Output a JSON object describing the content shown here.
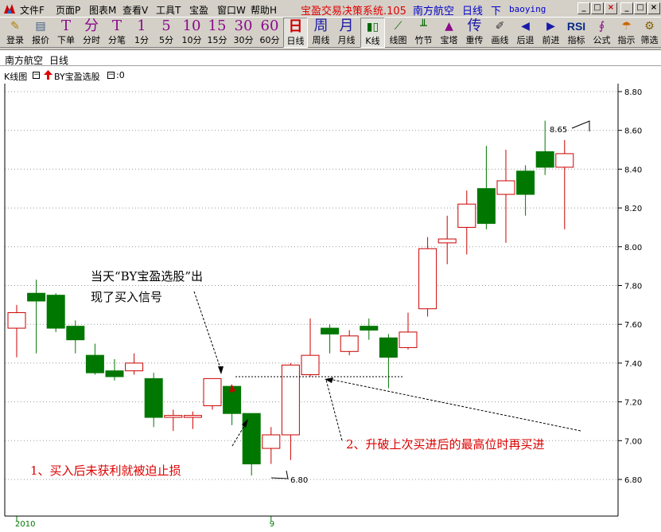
{
  "menu": {
    "items": [
      "文件F",
      "页面P",
      "图表M",
      "查看V",
      "工具T",
      "宝盈",
      "窗口W",
      "帮助H"
    ],
    "app_title": "宝盈交易决策系统.105",
    "stock_name": "南方航空",
    "period": "日线",
    "down_label": "下",
    "user": "baoying"
  },
  "toolbar": {
    "buttons": [
      {
        "icon": "✎",
        "label": "登录",
        "icon_name": "pen-icon"
      },
      {
        "icon": "▤",
        "label": "报价",
        "icon_name": "quote-icon"
      },
      {
        "icon": "T",
        "label": "下单",
        "icon_name": "order-icon"
      },
      {
        "icon": "分",
        "label": "分时",
        "icon_name": "minute-icon"
      },
      {
        "icon": "T",
        "label": "分笔",
        "icon_name": "tick-icon"
      },
      {
        "icon": "1",
        "label": "1分"
      },
      {
        "icon": "5",
        "label": "5分"
      },
      {
        "icon": "10",
        "label": "10分"
      },
      {
        "icon": "15",
        "label": "15分"
      },
      {
        "icon": "30",
        "label": "30分"
      },
      {
        "icon": "60",
        "label": "60分"
      },
      {
        "icon": "日",
        "label": "日线"
      },
      {
        "icon": "周",
        "label": "周线"
      },
      {
        "icon": "月",
        "label": "月线"
      },
      {
        "icon": "▮▯",
        "label": "K线",
        "icon_name": "candlestick-icon"
      },
      {
        "icon": "⟋",
        "label": "线图",
        "icon_name": "line-chart-icon"
      },
      {
        "icon": "╨",
        "label": "竹节",
        "icon_name": "bamboo-icon"
      },
      {
        "icon": "▲",
        "label": "宝塔",
        "icon_name": "tower-icon"
      },
      {
        "icon": "传",
        "label": "重传"
      },
      {
        "icon": "✐",
        "label": "画线",
        "icon_name": "draw-line-icon"
      },
      {
        "icon": "◀",
        "label": "后退",
        "icon_name": "back-icon"
      },
      {
        "icon": "▶",
        "label": "前进",
        "icon_name": "forward-icon"
      },
      {
        "icon": "RSI",
        "label": "指标",
        "icon_name": "rsi-icon"
      },
      {
        "icon": "∮",
        "label": "公式",
        "icon_name": "formula-icon"
      },
      {
        "icon": "☂",
        "label": "指示",
        "icon_name": "indicator-icon"
      },
      {
        "icon": "⚙",
        "label": "筛选",
        "icon_name": "filter-icon"
      }
    ]
  },
  "panel": {
    "stock_name": "南方航空",
    "period": "日线",
    "chart_label": "K线图",
    "indicator": "BY宝盈选股",
    "indicator_value": ":0"
  },
  "annotations": {
    "signal_line1": "当天“BY宝盈选股”出",
    "signal_line2": "现了买入信号",
    "note1": "1、买入后未获利就被迫止损",
    "note2": "2、升破上次买进后的最高位时再买进",
    "high_label": "8.65",
    "low_label": "6.80"
  },
  "colors": {
    "up": "#cc0000",
    "down": "#007700",
    "axis": "#000000",
    "grid": "#999999",
    "annotation_red": "#dd0000"
  },
  "chart_data": {
    "type": "candlestick",
    "ylim": [
      6.6,
      8.85
    ],
    "yticks": [
      6.8,
      7.0,
      7.2,
      7.4,
      7.6,
      7.8,
      8.0,
      8.2,
      8.4,
      8.6,
      8.8
    ],
    "ytick_labels": [
      "6.80",
      "7.00",
      "7.20",
      "7.40",
      "7.60",
      "7.80",
      "8.00",
      "8.20",
      "8.40",
      "8.60",
      "8.80"
    ],
    "x_labels": [
      {
        "index": 0,
        "text": "2010"
      },
      {
        "index": 13,
        "text": "9"
      }
    ],
    "candles": [
      {
        "o": 7.58,
        "h": 7.7,
        "l": 7.43,
        "c": 7.66
      },
      {
        "o": 7.76,
        "h": 7.83,
        "l": 7.45,
        "c": 7.72
      },
      {
        "o": 7.75,
        "h": 7.76,
        "l": 7.56,
        "c": 7.58
      },
      {
        "o": 7.59,
        "h": 7.62,
        "l": 7.45,
        "c": 7.52
      },
      {
        "o": 7.44,
        "h": 7.5,
        "l": 7.34,
        "c": 7.35
      },
      {
        "o": 7.36,
        "h": 7.42,
        "l": 7.31,
        "c": 7.33
      },
      {
        "o": 7.36,
        "h": 7.45,
        "l": 7.34,
        "c": 7.4
      },
      {
        "o": 7.32,
        "h": 7.35,
        "l": 7.07,
        "c": 7.12
      },
      {
        "o": 7.12,
        "h": 7.16,
        "l": 7.05,
        "c": 7.13
      },
      {
        "o": 7.12,
        "h": 7.15,
        "l": 7.06,
        "c": 7.13
      },
      {
        "o": 7.18,
        "h": 7.32,
        "l": 7.16,
        "c": 7.32
      },
      {
        "o": 7.28,
        "h": 7.28,
        "l": 7.08,
        "c": 7.14
      },
      {
        "o": 7.14,
        "h": 7.14,
        "l": 6.82,
        "c": 6.88
      },
      {
        "o": 6.96,
        "h": 7.07,
        "l": 6.88,
        "c": 7.03
      },
      {
        "o": 7.03,
        "h": 7.4,
        "l": 6.9,
        "c": 7.39
      },
      {
        "o": 7.34,
        "h": 7.63,
        "l": 7.33,
        "c": 7.44
      },
      {
        "o": 7.58,
        "h": 7.6,
        "l": 7.45,
        "c": 7.55
      },
      {
        "o": 7.46,
        "h": 7.57,
        "l": 7.44,
        "c": 7.54
      },
      {
        "o": 7.59,
        "h": 7.63,
        "l": 7.52,
        "c": 7.57
      },
      {
        "o": 7.53,
        "h": 7.55,
        "l": 7.27,
        "c": 7.43
      },
      {
        "o": 7.48,
        "h": 7.66,
        "l": 7.47,
        "c": 7.56
      },
      {
        "o": 7.68,
        "h": 8.05,
        "l": 7.64,
        "c": 7.99
      },
      {
        "o": 8.02,
        "h": 8.16,
        "l": 7.91,
        "c": 8.04
      },
      {
        "o": 8.1,
        "h": 8.29,
        "l": 7.96,
        "c": 8.22
      },
      {
        "o": 8.3,
        "h": 8.52,
        "l": 8.09,
        "c": 8.12
      },
      {
        "o": 8.27,
        "h": 8.5,
        "l": 8.02,
        "c": 8.34
      },
      {
        "o": 8.39,
        "h": 8.42,
        "l": 8.16,
        "c": 8.27
      },
      {
        "o": 8.49,
        "h": 8.65,
        "l": 8.37,
        "c": 8.41
      },
      {
        "o": 8.41,
        "h": 8.55,
        "l": 8.09,
        "c": 8.48
      }
    ]
  }
}
